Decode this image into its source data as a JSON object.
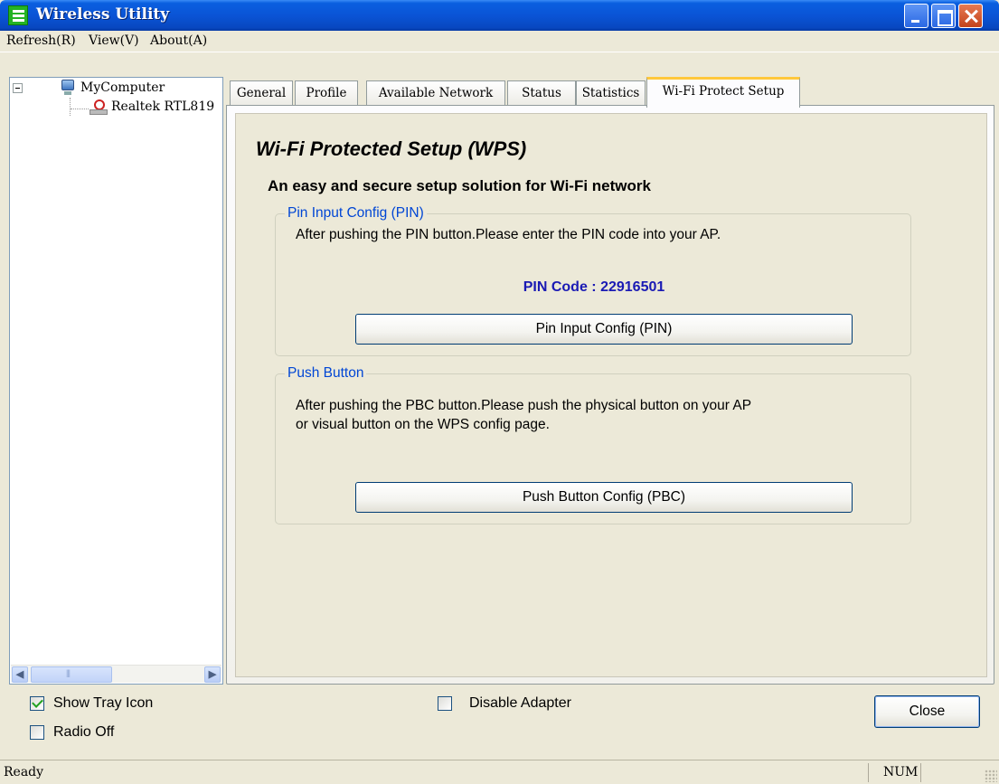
{
  "window": {
    "title": "Wireless Utility"
  },
  "menu": {
    "items": [
      {
        "label": "Refresh(R)"
      },
      {
        "label": "View(V)"
      },
      {
        "label": "About(A)"
      }
    ]
  },
  "tree": {
    "root_label": "MyComputer",
    "child_label": "Realtek RTL819"
  },
  "tabs": [
    {
      "label": "General"
    },
    {
      "label": "Profile"
    },
    {
      "label": "Available Network"
    },
    {
      "label": "Status"
    },
    {
      "label": "Statistics"
    },
    {
      "label": "Wi-Fi Protect Setup"
    }
  ],
  "wps": {
    "title": "Wi-Fi Protected Setup (WPS)",
    "subtitle": "An easy and secure setup solution for Wi-Fi network",
    "pin_group": {
      "legend": "Pin Input Config (PIN)",
      "description": "After pushing the PIN button.Please enter the PIN code into your AP.",
      "pin_code_text": "PIN Code :  22916501",
      "button_label": "Pin Input Config (PIN)"
    },
    "pbc_group": {
      "legend": "Push Button",
      "description_line1": "After pushing the PBC button.Please push the physical button on your AP",
      "description_line2": "or visual button on the WPS config page.",
      "button_label": "Push Button Config (PBC)"
    }
  },
  "options": {
    "show_tray_icon": {
      "label": "Show Tray Icon",
      "checked": true
    },
    "radio_off": {
      "label": "Radio Off",
      "checked": false
    },
    "disable_adapter": {
      "label": "Disable Adapter",
      "checked": false
    }
  },
  "close_button": "Close",
  "statusbar": {
    "text": "Ready",
    "num": "NUM"
  },
  "colors": {
    "titlebar": "#0a54d6",
    "group_legend": "#0046d5",
    "pin_code": "#1a1ab4",
    "active_tab_accent": "#ffc83c"
  }
}
